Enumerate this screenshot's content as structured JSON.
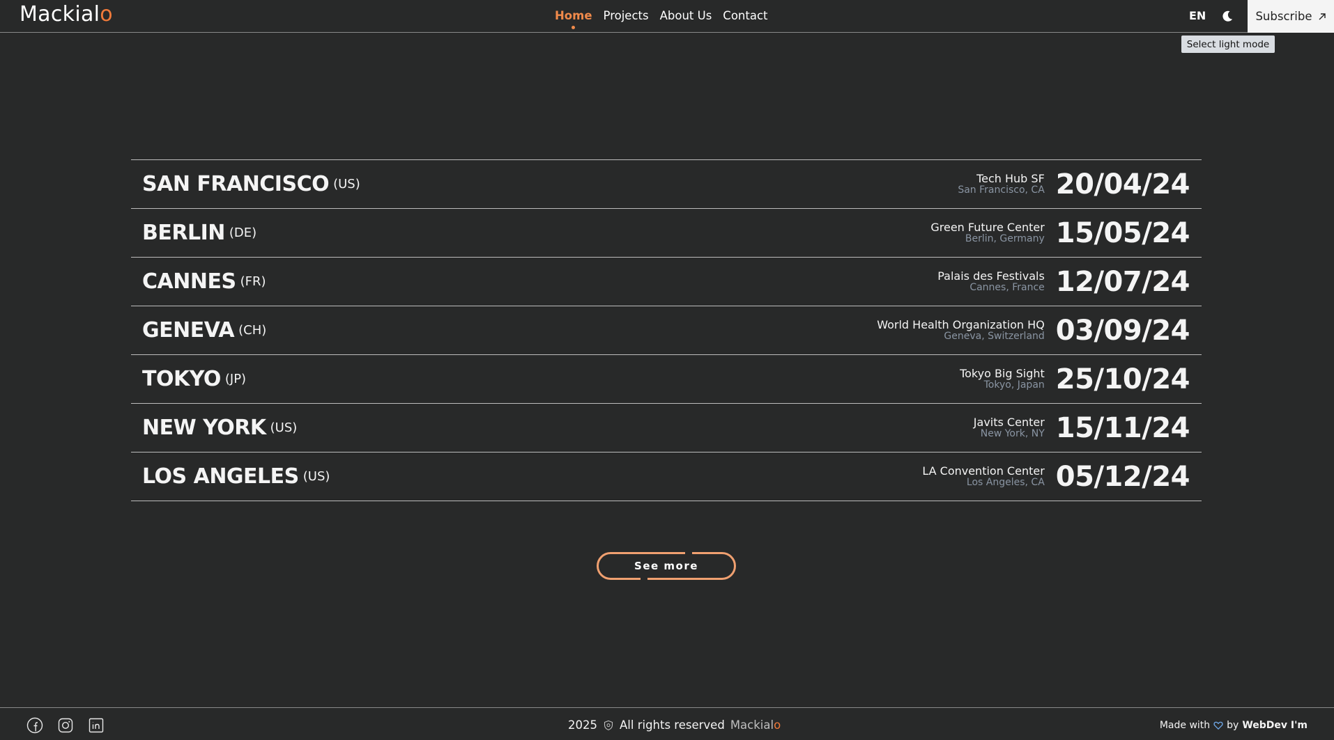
{
  "header": {
    "logo_main": "Mackial",
    "logo_accent": "o",
    "nav": [
      {
        "label": "Home",
        "active": true
      },
      {
        "label": "Projects",
        "active": false
      },
      {
        "label": "About Us",
        "active": false
      },
      {
        "label": "Contact",
        "active": false
      }
    ],
    "language": "EN",
    "theme_icon": "moon-icon",
    "subscribe_label": "Subscribe",
    "subscribe_icon": "arrow-up-right-icon",
    "tooltip": "Select light mode"
  },
  "events": [
    {
      "city": "SAN FRANCISCO",
      "country": "(US)",
      "venue": "Tech Hub SF",
      "location": "San Francisco, CA",
      "date": "20/04/24"
    },
    {
      "city": "BERLIN",
      "country": "(DE)",
      "venue": "Green Future Center",
      "location": "Berlin, Germany",
      "date": "15/05/24"
    },
    {
      "city": "CANNES",
      "country": "(FR)",
      "venue": "Palais des Festivals",
      "location": "Cannes, France",
      "date": "12/07/24"
    },
    {
      "city": "GENEVA",
      "country": "(CH)",
      "venue": "World Health Organization HQ",
      "location": "Geneva, Switzerland",
      "date": "03/09/24"
    },
    {
      "city": "TOKYO",
      "country": "(JP)",
      "venue": "Tokyo Big Sight",
      "location": "Tokyo, Japan",
      "date": "25/10/24"
    },
    {
      "city": "NEW YORK",
      "country": "(US)",
      "venue": "Javits Center",
      "location": "New York, NY",
      "date": "15/11/24"
    },
    {
      "city": "LOS ANGELES",
      "country": "(US)",
      "venue": "LA Convention Center",
      "location": "Los Angeles, CA",
      "date": "05/12/24"
    }
  ],
  "see_more_label": "See more",
  "footer": {
    "social_icons": [
      "facebook-icon",
      "instagram-icon",
      "linkedin-icon"
    ],
    "year": "2025",
    "copyright_icon": "shield-icon",
    "rights_text": "All rights reserved",
    "brand_main": "Mackial",
    "brand_accent": "o",
    "made_with": "Made with",
    "heart_icon": "heart-icon",
    "by": "by",
    "author": "WebDev I'm"
  },
  "colors": {
    "background": "#282929",
    "accent": "#f07a3a",
    "button_border": "#f0a070",
    "muted_text": "#8a95a3"
  }
}
